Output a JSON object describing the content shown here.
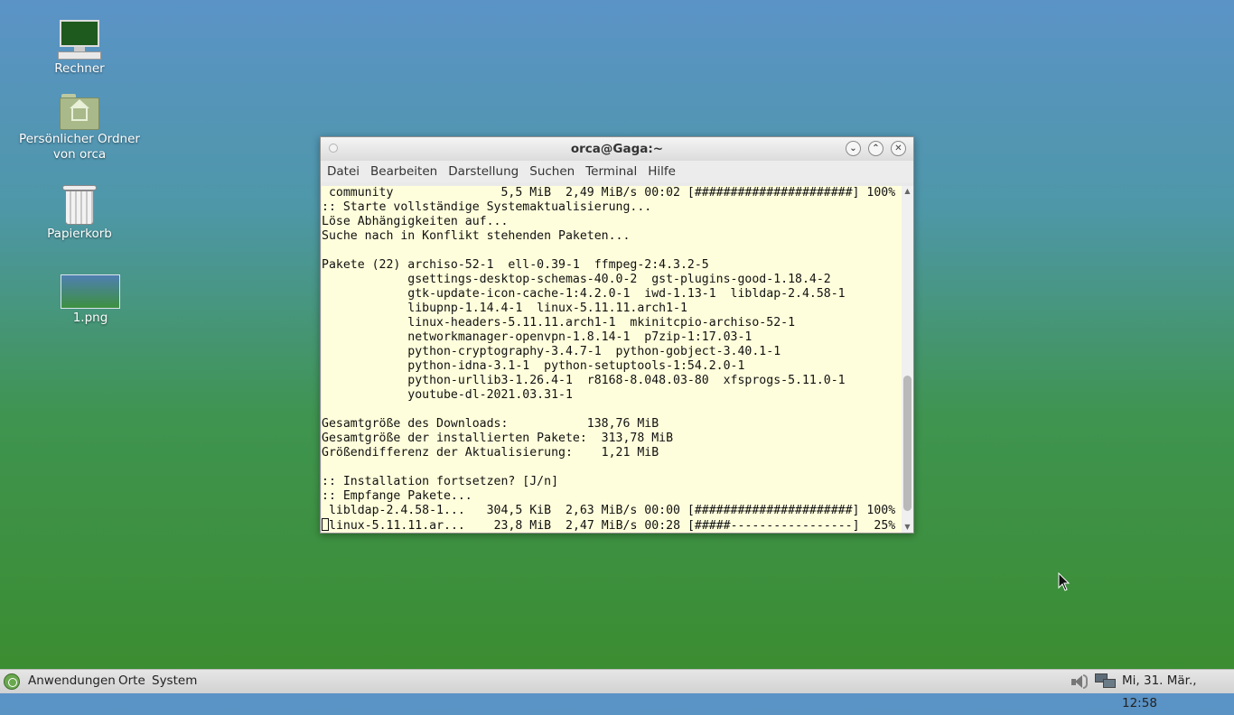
{
  "desktop": {
    "icons": [
      {
        "label": "Rechner",
        "icon": "computer-icon"
      },
      {
        "label": "Persönlicher Ordner\nvon orca",
        "icon": "home-folder-icon"
      },
      {
        "label": "Papierkorb",
        "icon": "trash-icon"
      },
      {
        "label": "1.png",
        "icon": "image-file-icon"
      }
    ]
  },
  "window": {
    "title": "orca@Gaga:~",
    "buttons": {
      "minimize": "⌄",
      "maximize": "⌃",
      "close": "✕"
    },
    "menu": [
      "Datei",
      "Bearbeiten",
      "Darstellung",
      "Suchen",
      "Terminal",
      "Hilfe"
    ],
    "terminal_lines": [
      " community               5,5 MiB  2,49 MiB/s 00:02 [######################] 100%",
      ":: Starte vollständige Systemaktualisierung...",
      "Löse Abhängigkeiten auf...",
      "Suche nach in Konflikt stehenden Paketen...",
      "",
      "Pakete (22) archiso-52-1  ell-0.39-1  ffmpeg-2:4.3.2-5",
      "            gsettings-desktop-schemas-40.0-2  gst-plugins-good-1.18.4-2",
      "            gtk-update-icon-cache-1:4.2.0-1  iwd-1.13-1  libldap-2.4.58-1",
      "            libupnp-1.14.4-1  linux-5.11.11.arch1-1",
      "            linux-headers-5.11.11.arch1-1  mkinitcpio-archiso-52-1",
      "            networkmanager-openvpn-1.8.14-1  p7zip-1:17.03-1",
      "            python-cryptography-3.4.7-1  python-gobject-3.40.1-1",
      "            python-idna-3.1-1  python-setuptools-1:54.2.0-1",
      "            python-urllib3-1.26.4-1  r8168-8.048.03-80  xfsprogs-5.11.0-1",
      "            youtube-dl-2021.03.31-1",
      "",
      "Gesamtgröße des Downloads:           138,76 MiB",
      "Gesamtgröße der installierten Pakete:  313,78 MiB",
      "Größendifferenz der Aktualisierung:    1,21 MiB",
      "",
      ":: Installation fortsetzen? [J/n]",
      ":: Empfange Pakete...",
      " libldap-2.4.58-1...   304,5 KiB  2,63 MiB/s 00:00 [######################] 100%"
    ],
    "last_line": "linux-5.11.11.ar...    23,8 MiB  2,47 MiB/s 00:28 [#####-----------------]  25%"
  },
  "taskbar": {
    "menus": [
      "Anwendungen",
      "Orte",
      "System"
    ],
    "clock": "Mi, 31. Mär., 12:58"
  }
}
